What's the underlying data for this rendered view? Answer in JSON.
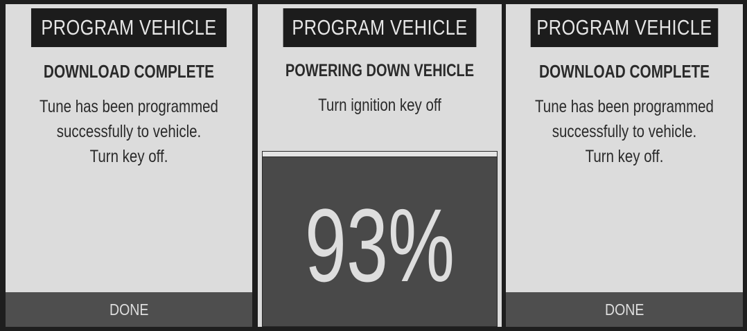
{
  "screens": [
    {
      "title": "PROGRAM VEHICLE",
      "heading": "DOWNLOAD COMPLETE",
      "message_lines": [
        "Tune has been programmed",
        "successfully to vehicle.",
        "Turn key off."
      ],
      "button_label": "DONE"
    },
    {
      "title": "PROGRAM VEHICLE",
      "heading": "POWERING DOWN VEHICLE",
      "message_lines": [
        "Turn ignition key off"
      ],
      "progress_percent": 93,
      "progress_label": "93%"
    },
    {
      "title": "PROGRAM VEHICLE",
      "heading": "DOWNLOAD COMPLETE",
      "message_lines": [
        "Tune has been programmed",
        "successfully to vehicle.",
        "Turn key off."
      ],
      "button_label": "DONE"
    }
  ]
}
